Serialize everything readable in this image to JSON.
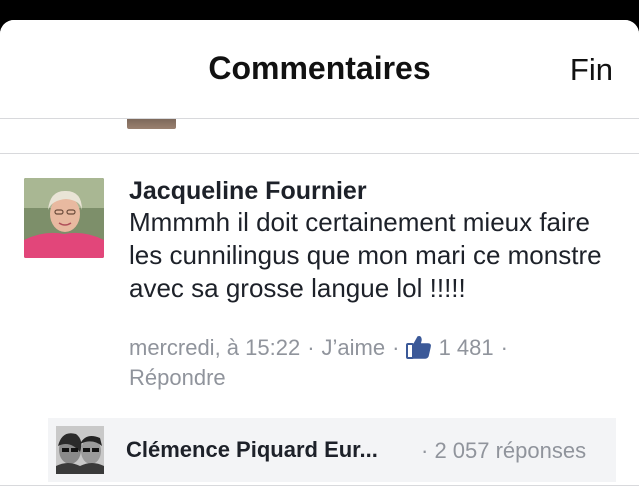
{
  "header": {
    "title": "Commentaires",
    "done_label": "Fin"
  },
  "comment": {
    "author": "Jacqueline Fournier",
    "text": "Mmmmh il doit certainement mieux faire les cunnilingus que mon mari ce monstre avec sa grosse langue lol !!!!!",
    "timestamp": "mercredi, à 15:22",
    "separator": "·",
    "like_label": "J’aime",
    "like_count": "1 481",
    "reply_label": "Répondre"
  },
  "replies": {
    "author": "Clémence Piquard Eur...",
    "summary": "· 2 057 réponses"
  },
  "colors": {
    "accent": "#3b5998",
    "meta_text": "#90949c",
    "primary_text": "#1d2129",
    "divider": "#d8d9dc"
  }
}
